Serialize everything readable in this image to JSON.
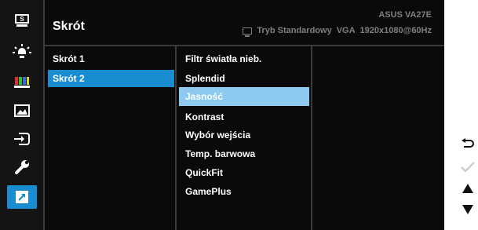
{
  "header": {
    "title": "Skrót",
    "model": "ASUS  VA27E",
    "mode": "Tryb Standardowy",
    "input": "VGA",
    "resolution": "1920x1080@60Hz"
  },
  "sidebar_icons": [
    "splendid-icon",
    "blue-light-filter-icon",
    "color-icon",
    "image-icon",
    "input-select-icon",
    "system-setup-icon",
    "shortcut-icon"
  ],
  "level1": [
    "Skrót 1",
    "Skrót 2"
  ],
  "level2": [
    "Filtr światła nieb.",
    "Splendid",
    "Jasność",
    "Kontrast",
    "Wybór wejścia",
    "Temp. barwowa",
    "QuickFit",
    "GamePlus"
  ],
  "nav_buttons": [
    "back-icon",
    "confirm-icon",
    "up-icon",
    "down-icon"
  ],
  "colors": {
    "selected_icon": "#1a8dd1",
    "selected_level1": "#1a8dd1",
    "selected_level2": "#8ecaef"
  }
}
